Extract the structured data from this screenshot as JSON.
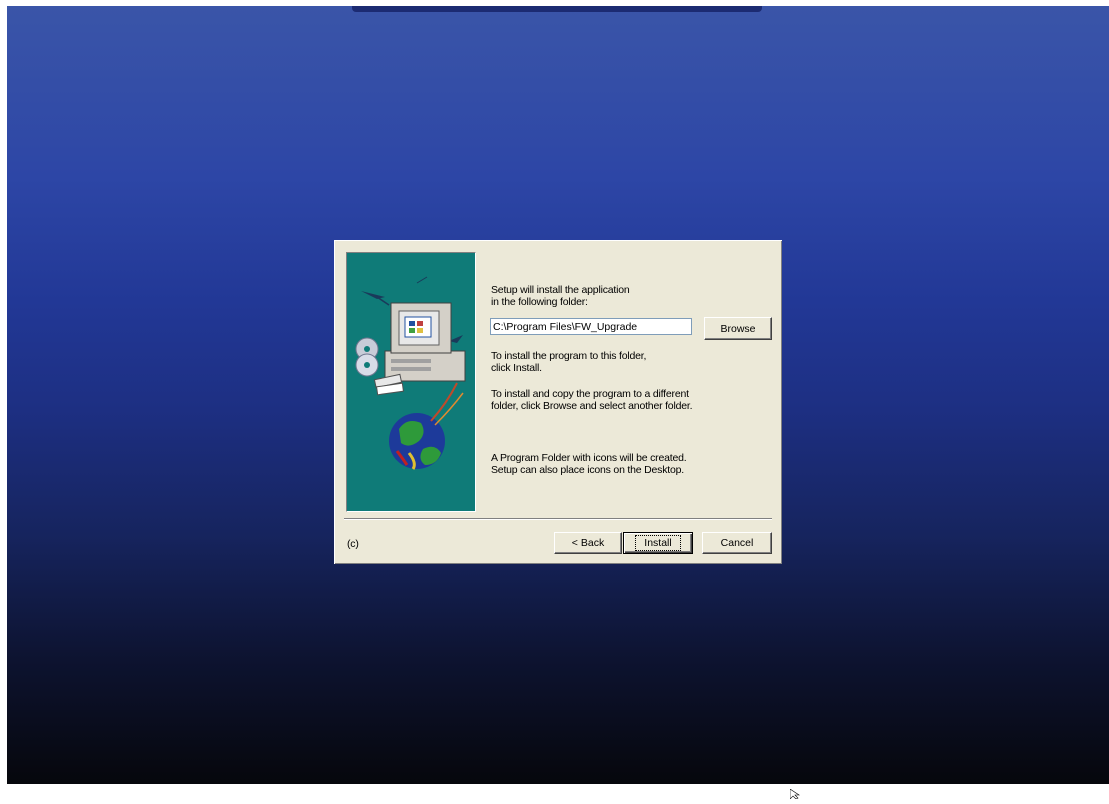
{
  "dialog": {
    "intro_line1": "Setup will install the application",
    "intro_line2": "in the following folder:",
    "install_path": "C:\\Program Files\\FW_Upgrade",
    "browse_label": "Browse",
    "install_hint_line1": "To install the program to this folder,",
    "install_hint_line2": "click Install.",
    "browse_hint_line1": "To install and copy the program to a different",
    "browse_hint_line2": "folder, click Browse and select another folder.",
    "folder_note_line1": "A Program Folder with icons will be created.",
    "folder_note_line2": "Setup can also place icons on the Desktop.",
    "copyright": "(c)",
    "back_label": "< Back",
    "install_label": "Install",
    "cancel_label": "Cancel"
  },
  "colors": {
    "desktop_top": "#3a55a8",
    "desktop_bottom": "#06070c",
    "dialog_bg": "#ece9d8",
    "side_panel": "#0f7b78"
  },
  "icons": {
    "side_image": "computer-with-discs-and-globe",
    "cursor": "mouse-pointer-arrow"
  }
}
